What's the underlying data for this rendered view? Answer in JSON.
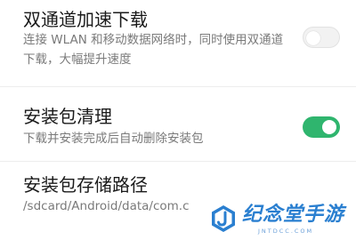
{
  "settings": [
    {
      "title": "双通道加速下载",
      "description_lines": [
        "连接 WLAN 和移动数据网络时，同时使用双通道",
        "下载，大幅提升速度"
      ],
      "toggle": "off"
    },
    {
      "title": "安装包清理",
      "description_lines": [
        "下载并安装完成后自动删除安装包"
      ],
      "toggle": "on"
    },
    {
      "title": "安装包存储路径",
      "description_lines": [
        "/sdcard/Android/data/com.c"
      ]
    }
  ],
  "watermark": {
    "title": "纪念堂手游",
    "subtitle": "JNTDCC.COM"
  },
  "colors": {
    "toggle_on": "#2fb56e",
    "watermark": "#2a7fd0"
  }
}
